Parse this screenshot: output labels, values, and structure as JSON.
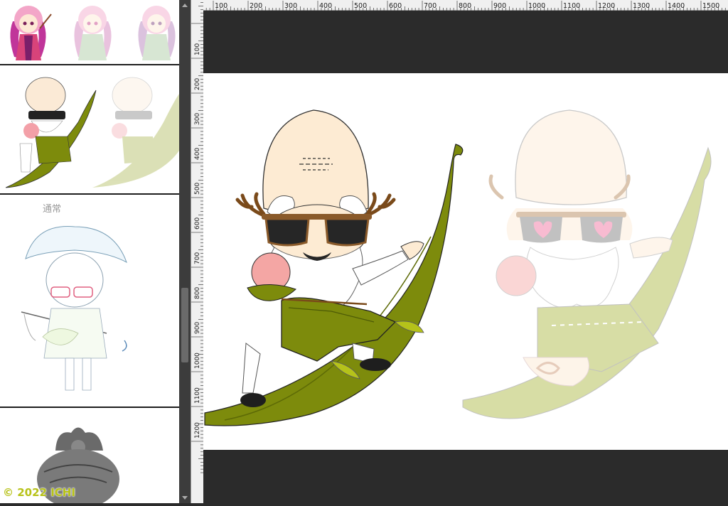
{
  "ruler": {
    "horizontal_labels": [
      "100",
      "200",
      "300",
      "400",
      "500",
      "600",
      "700",
      "800",
      "900",
      "1000",
      "1100",
      "1200",
      "1300",
      "1400",
      "1500"
    ],
    "vertical_labels": [
      "100",
      "200",
      "300",
      "400",
      "500",
      "600",
      "700",
      "800",
      "900",
      "1000",
      "1100",
      "1200"
    ]
  },
  "sidebar": {
    "thumbnails": [
      {
        "name": "fox-girl-sketches"
      },
      {
        "name": "old-man-on-leaf"
      },
      {
        "name": "fisher-boy",
        "label": "通常"
      },
      {
        "name": "grey-character"
      }
    ],
    "copyright": "© 2022 ICHI"
  },
  "colors": {
    "leaf": "#7d8b0c",
    "leaf_light": "#b5c21a",
    "skin": "#fde9d5",
    "ui_dark": "#2b2b2b",
    "ruler": "#f0f0f0"
  }
}
